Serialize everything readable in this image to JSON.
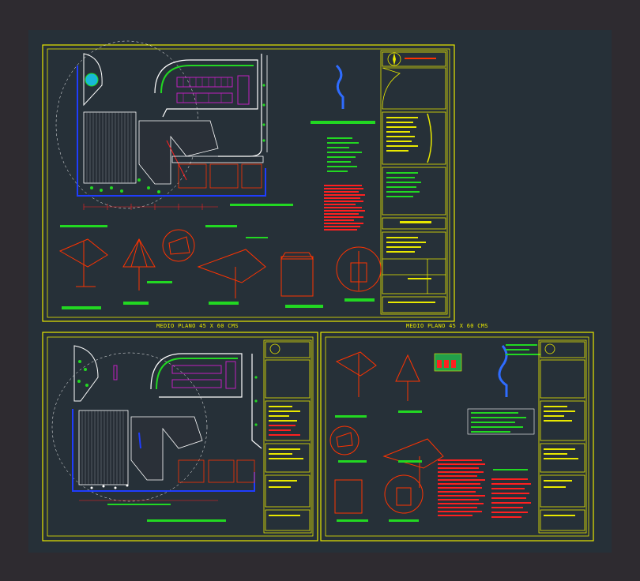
{
  "labels": {
    "sheet_bottom_left_caption": "MEDIO PLANO  45 X 60 CMS",
    "sheet_bottom_right_caption": "MEDIO PLANO  45 X 60 CMS"
  },
  "colors": {
    "page_bg": "#2e2b30",
    "model_space": "#263038",
    "frame": "#e8e800",
    "site_lines": "#ffffff",
    "walls": "#1f3dff",
    "landscape": "#22d822",
    "parking": "#c020c0",
    "structure": "#ff3300",
    "annotation": "#ff2020",
    "detail_blue": "#2f6cff"
  },
  "icons": {
    "north_arrow": "compass-rose-icon",
    "site_plan": "site-plan-drawing",
    "structure_details": "umbrella-structure-detail-drawings"
  }
}
